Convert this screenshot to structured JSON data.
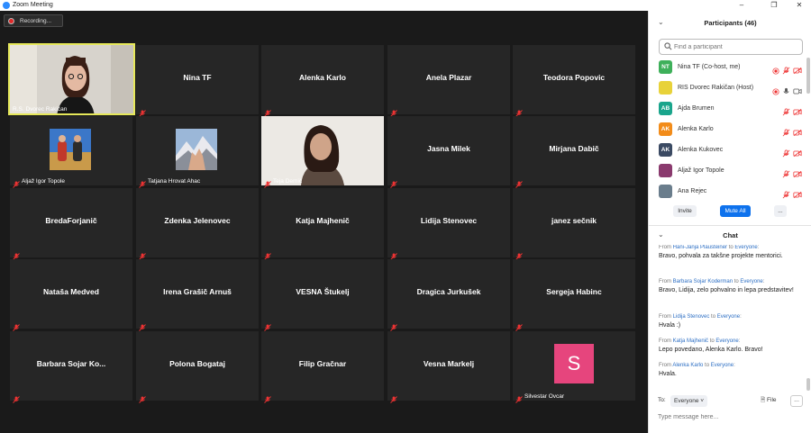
{
  "window": {
    "title": "Zoom Meeting"
  },
  "recording": {
    "label": "Recording..."
  },
  "tiles": [
    {
      "name": "R.S. Dvorec Rakičan",
      "type": "video_woman"
    },
    {
      "name": "Nina TF",
      "type": "name"
    },
    {
      "name": "Alenka Karlo",
      "type": "name"
    },
    {
      "name": "Anela Plazar",
      "type": "name"
    },
    {
      "name": "Teodora Popovic",
      "type": "name"
    },
    {
      "name": "Aljaž Igor Topole",
      "type": "photo_couple"
    },
    {
      "name": "Tatjana Hrovat Ahac",
      "type": "photo_mountain"
    },
    {
      "name": "Teja Demič",
      "type": "video_teja"
    },
    {
      "name": "Jasna Milek",
      "type": "name"
    },
    {
      "name": "Mirjana Dabič",
      "type": "name"
    },
    {
      "name": "BredaForjanič",
      "type": "name"
    },
    {
      "name": "Zdenka Jelenovec",
      "type": "name"
    },
    {
      "name": "Katja Majhenič",
      "type": "name"
    },
    {
      "name": "Lidija Stenovec",
      "type": "name"
    },
    {
      "name": "janez sečnik",
      "type": "name"
    },
    {
      "name": "Nataša Medved",
      "type": "name"
    },
    {
      "name": "Irena Grašič Arnuš",
      "type": "name"
    },
    {
      "name": "VESNA Štukelj",
      "type": "name"
    },
    {
      "name": "Dragica Jurkušek",
      "type": "name"
    },
    {
      "name": "Sergeja Habinc",
      "type": "name"
    },
    {
      "name": "Barbara Sojar Ko...",
      "type": "name"
    },
    {
      "name": "Polona Bogataj",
      "type": "name"
    },
    {
      "name": "Filip Gračnar",
      "type": "name"
    },
    {
      "name": "Vesna Markelj",
      "type": "name"
    },
    {
      "name": "Silvestar Ovcar",
      "type": "avatar",
      "initial": "S",
      "color": "#e6457d"
    }
  ],
  "participants": {
    "title": "Participants (46)",
    "search_placeholder": "Find a participant",
    "list": [
      {
        "initials": "NT",
        "color": "#3eb05a",
        "name": "Nina TF (Co-host, me)"
      },
      {
        "initials": "",
        "color": "#e8d23a",
        "name": "RIS Dvorec Rakičan (Host)"
      },
      {
        "initials": "AB",
        "color": "#1aa58c",
        "name": "Ajda Brumen"
      },
      {
        "initials": "AK",
        "color": "#f28c1a",
        "name": "Alenka Karlo"
      },
      {
        "initials": "AK",
        "color": "#3b4a63",
        "name": "Alenka Kukovec"
      },
      {
        "initials": "",
        "color": "#8a3a6e",
        "name": "Aljaž Igor Topole"
      },
      {
        "initials": "",
        "color": "#6a7d8c",
        "name": "Ana Rejec"
      }
    ],
    "invite_label": "Invite",
    "mute_all_label": "Mute All",
    "more_label": "..."
  },
  "chat": {
    "title": "Chat",
    "messages": [
      {
        "from": "Hani-Janja Plausteiner",
        "to": "Everyone",
        "text": "Bravo, pohvala za takšne projekte mentorici."
      },
      {
        "from": "Barbara Sojar Koderman",
        "to": "Everyone",
        "text": "Bravo, Lidija, zelo pohvalno in lepa predstavitev!"
      },
      {
        "from": "Lidija Stenovec",
        "to": "Everyone",
        "text": "Hvala :)"
      },
      {
        "from": "Katja Majhenič",
        "to": "Everyone",
        "text": "Lepo povedano, Alenka Karlo. Bravo!"
      },
      {
        "from": "Alenka Karlo",
        "to": "Everyone",
        "text": "Hvala."
      }
    ],
    "from_word": "From",
    "to_word": "to",
    "to_label": "To:",
    "recipient": "Everyone",
    "file_label": "File",
    "more_label": "...",
    "input_placeholder": "Type message here..."
  }
}
